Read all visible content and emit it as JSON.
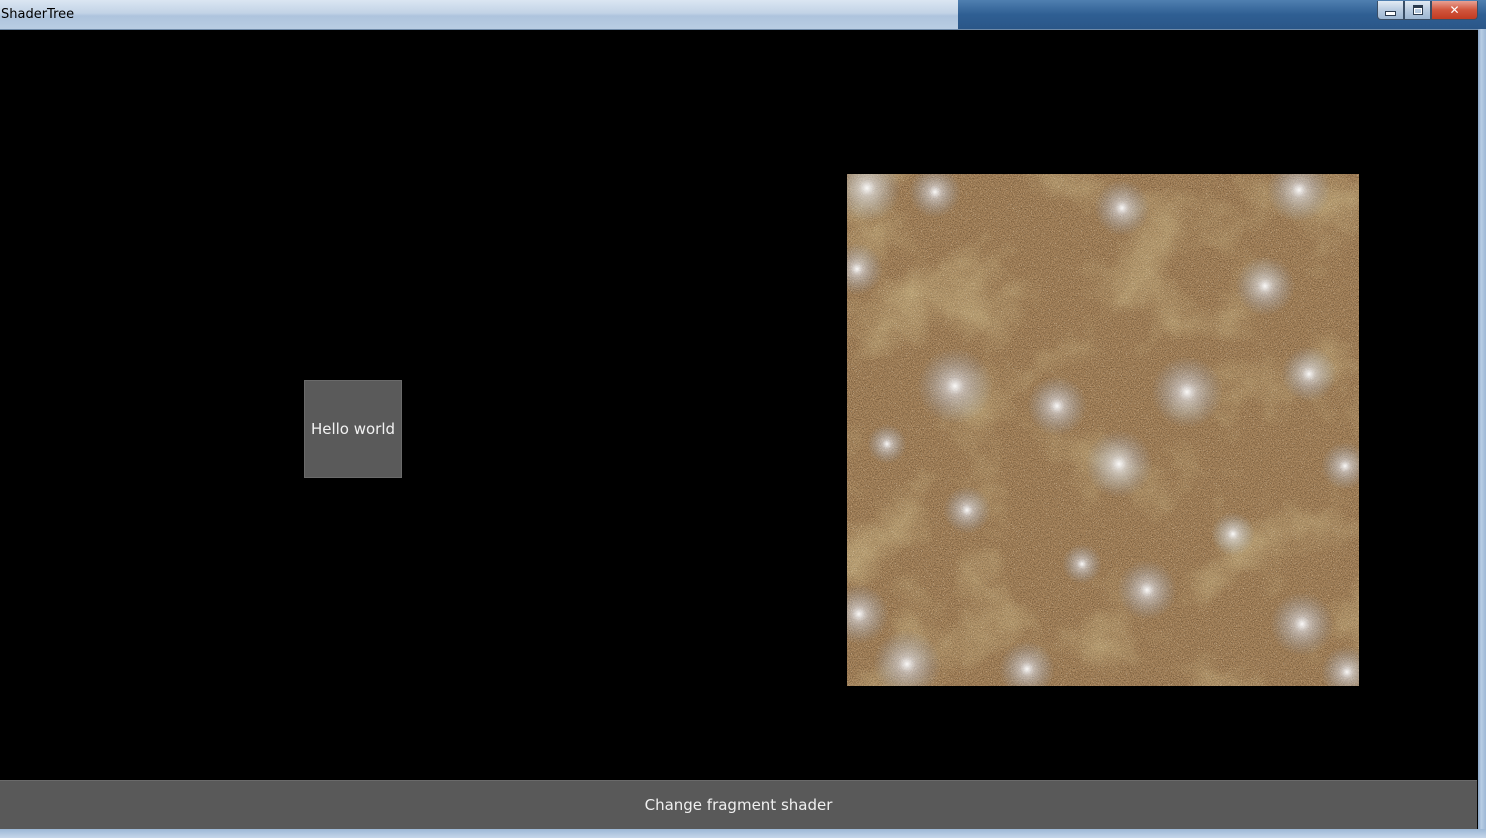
{
  "window": {
    "title": "ShaderTree"
  },
  "caption_buttons": {
    "minimize_icon": "minimize-icon",
    "maximize_icon": "maximize-icon",
    "close_icon": "close-icon",
    "close_glyph": "✕"
  },
  "content": {
    "hello_button_label": "Hello world",
    "change_shader_button_label": "Change fragment shader"
  },
  "colors": {
    "button_bg": "#5a5a5a",
    "background": "#000000",
    "shader_base": "#3a2414"
  }
}
